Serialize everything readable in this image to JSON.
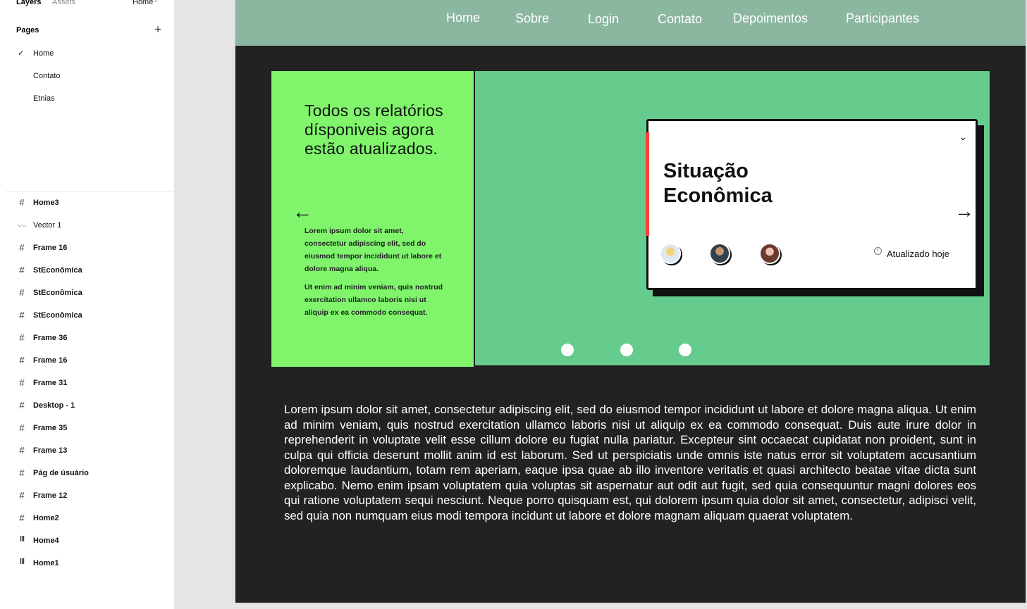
{
  "panel": {
    "tabs": {
      "layers": "Layers",
      "assets": "Assets"
    },
    "current_page": "Home",
    "pages_title": "Pages",
    "add_page": "+",
    "pages": [
      {
        "label": "Home",
        "selected": true
      },
      {
        "label": "Contato",
        "selected": false
      },
      {
        "label": "Etnias",
        "selected": false
      }
    ],
    "layers": [
      {
        "label": "Home3",
        "icon": "frame-icon"
      },
      {
        "label": "Vector 1",
        "icon": "vector-icon"
      },
      {
        "label": "Frame 16",
        "icon": "frame-icon"
      },
      {
        "label": "StEconômica",
        "icon": "frame-icon"
      },
      {
        "label": "StEconômica",
        "icon": "frame-icon"
      },
      {
        "label": "StEconômica",
        "icon": "frame-icon"
      },
      {
        "label": "Frame 36",
        "icon": "frame-icon"
      },
      {
        "label": "Frame 16",
        "icon": "frame-icon"
      },
      {
        "label": "Frame 31",
        "icon": "frame-icon"
      },
      {
        "label": "Desktop - 1",
        "icon": "frame-icon"
      },
      {
        "label": "Frame 35",
        "icon": "frame-icon"
      },
      {
        "label": "Frame 13",
        "icon": "frame-icon"
      },
      {
        "label": "Pág de úsuário",
        "icon": "frame-icon"
      },
      {
        "label": "Frame 12",
        "icon": "frame-icon"
      },
      {
        "label": "Home2",
        "icon": "frame-icon"
      },
      {
        "label": "Home4",
        "icon": "layout-bars-icon"
      },
      {
        "label": "Home1",
        "icon": "layout-bars-icon"
      }
    ]
  },
  "site": {
    "nav": [
      "Home",
      "Sobre",
      "Login",
      "Contato",
      "Depoimentos",
      "Participantes"
    ],
    "hero": {
      "heading": "Todos os relatórios dísponiveis agora estão atualizados.",
      "p1": "Lorem ipsum dolor sit amet, consectetur adipiscing elit, sed do eiusmod tempor incididunt ut labore et dolore magna aliqua.",
      "p2": "Ut enim ad minim veniam, quis nostrud exercitation ullamco laboris nisi ut aliquip ex ea commodo consequat."
    },
    "card": {
      "title": "Situação Econômica",
      "updated": "Atualizado hoje"
    },
    "body_text": "Lorem ipsum dolor sit amet, consectetur adipiscing elit, sed do eiusmod tempor incididunt ut labore et dolore magna aliqua. Ut enim ad minim veniam, quis nostrud exercitation ullamco laboris nisi ut aliquip ex ea commodo consequat. Duis aute irure dolor in reprehenderit in voluptate velit esse cillum dolore eu fugiat nulla pariatur. Excepteur sint occaecat cupidatat non proident, sunt in culpa qui officia deserunt mollit anim id est laborum. Sed ut perspiciatis unde omnis iste natus error sit voluptatem accusantium doloremque laudantium, totam rem aperiam, eaque ipsa quae ab illo inventore veritatis et quasi architecto beatae vitae dicta sunt explicabo. Nemo enim ipsam voluptatem quia voluptas sit aspernatur aut odit aut fugit, sed quia consequuntur magni dolores eos qui ratione voluptatem sequi nesciunt. Neque porro quisquam est, qui dolorem ipsum quia dolor sit amet, consectetur, adipisci velit, sed quia non numquam eius modi tempora incidunt ut labore et dolore magnam aliquam quaerat voluptatem."
  },
  "colors": {
    "nav_bg": "#8bb7a0",
    "canvas_bg": "#222222",
    "hero_green": "#66cc8e",
    "hero_left": "#80f56c",
    "accent_red": "#ff3d3d"
  }
}
